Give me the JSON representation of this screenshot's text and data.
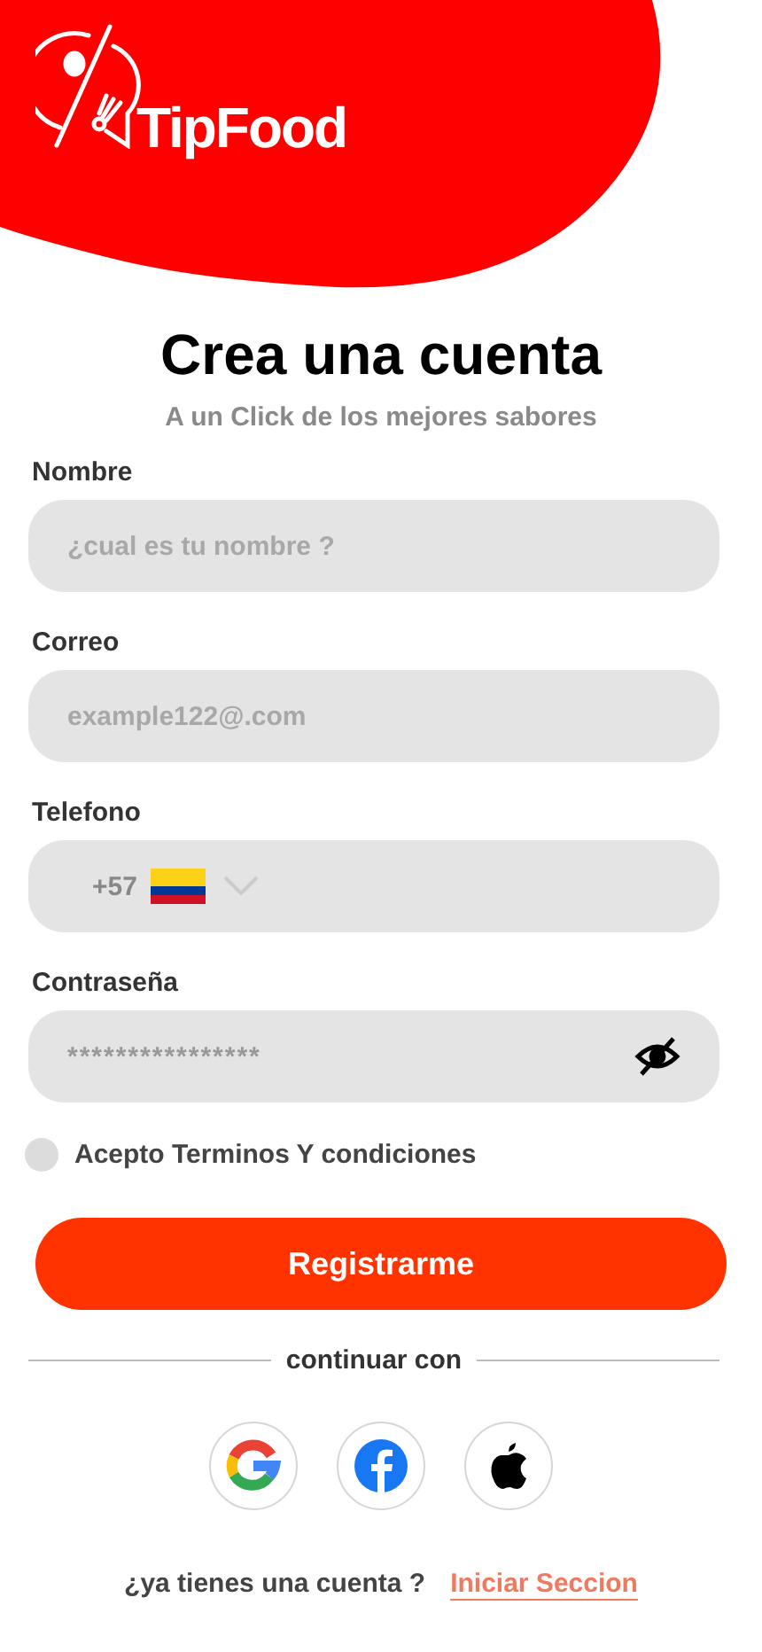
{
  "logo": {
    "text": "TipFood"
  },
  "title": "Crea una cuenta",
  "subtitle": "A un Click de los mejores sabores",
  "fields": [
    {
      "kind": "text",
      "label": "Nombre",
      "placeholder": "¿cual es tu nombre ?"
    },
    {
      "kind": "email",
      "label": "Correo",
      "placeholder": "example122@.com"
    },
    {
      "kind": "phone",
      "label": "Telefono",
      "code": "+57"
    },
    {
      "kind": "password",
      "label": "Contraseña",
      "value": "****************"
    }
  ],
  "terms": {
    "label": "Acepto Terminos Y condiciones",
    "checked": false
  },
  "submit": "Registrarme",
  "divider": "continuar con",
  "social": [
    {
      "kind": "google"
    },
    {
      "kind": "facebook"
    },
    {
      "kind": "apple"
    }
  ],
  "footer": {
    "question": "¿ya tienes una cuenta ?",
    "link": "Iniciar Seccion"
  }
}
